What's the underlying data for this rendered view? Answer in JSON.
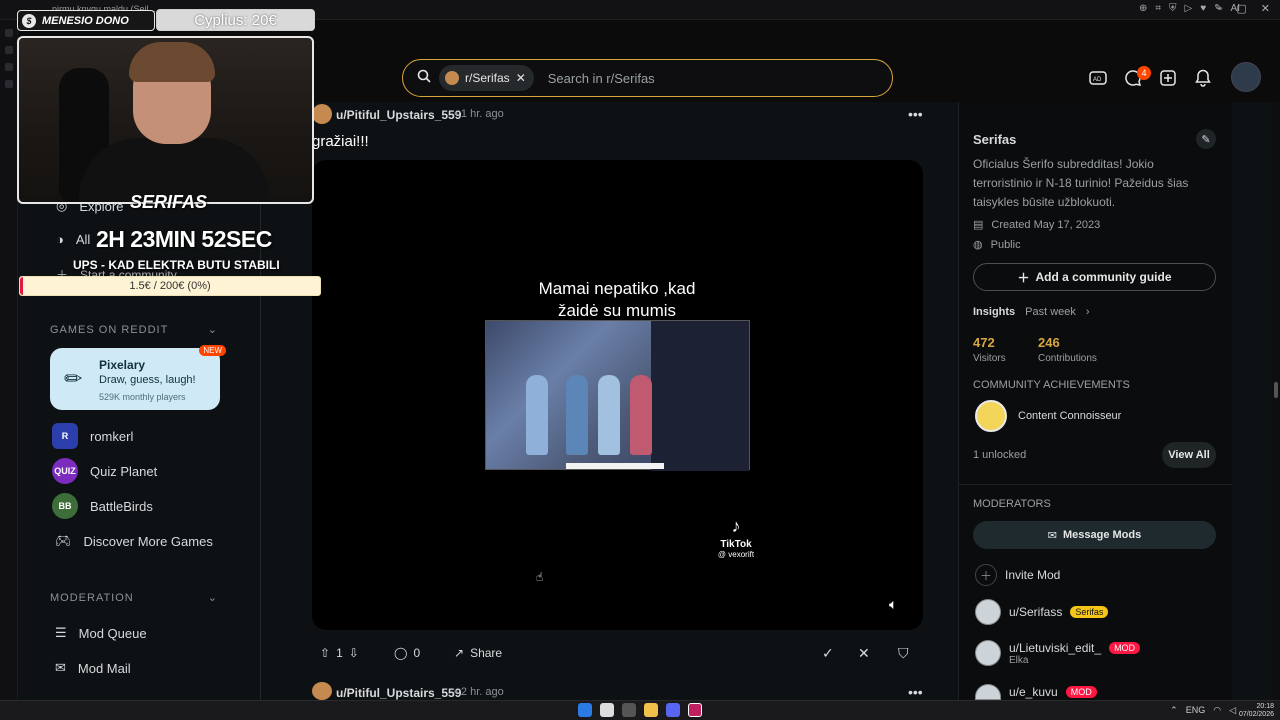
{
  "browser": {
    "tab_title": "pirmų knygų maldų (Seil...",
    "extension_label": "AI"
  },
  "overlay": {
    "streamer_name": "MENESIO DONO",
    "donation": "Cyplius: 20€",
    "channel_name": "SERIFAS",
    "timer": "2H 23MIN 52SEC",
    "goal_text": "UPS - KAD ELEKTRA BUTU STABILI",
    "goal_progress": "1.5€ / 200€ (0%)",
    "goal_fraction": 0.0075
  },
  "search": {
    "chip_label": "r/Serifas",
    "placeholder": "Search in r/Serifas"
  },
  "header": {
    "chat_badge": "4"
  },
  "sidebar": {
    "nav": [
      {
        "label": "Explore",
        "icon": "explore-icon"
      },
      {
        "label": "All",
        "icon": "all-icon"
      },
      {
        "label": "Start a community",
        "icon": "plus-icon"
      }
    ],
    "games_heading": "GAMES ON REDDIT",
    "featured_game": {
      "name": "Pixelary",
      "tagline": "Draw, guess, laugh!",
      "players": "529K monthly players",
      "badge": "NEW"
    },
    "games": [
      {
        "label": "romkerl",
        "icon": "R"
      },
      {
        "label": "Quiz Planet",
        "icon": "QUIZ"
      },
      {
        "label": "BattleBirds",
        "icon": "BB"
      },
      {
        "label": "Discover More Games",
        "icon": "gamepad-icon"
      }
    ],
    "moderation_heading": "MODERATION",
    "moderation": [
      {
        "label": "Mod Queue"
      },
      {
        "label": "Mod Mail"
      }
    ]
  },
  "post": {
    "author": "u/Pitiful_Upstairs_559",
    "time": "• 1 hr. ago",
    "title": "gražiai!!!",
    "video_caption_line1": "Mamai nepatiko ,kad",
    "video_caption_line2": "žaidė su mumis",
    "tiktok_name": "TikTok",
    "tiktok_handle": "@ vexorift",
    "votes": "1",
    "comments": "0",
    "share_label": "Share"
  },
  "post2": {
    "author": "u/Pitiful_Upstairs_559",
    "time": "• 2 hr. ago"
  },
  "community": {
    "name": "Serifas",
    "description": "Oficialus Šerifo subredditas! Jokio terroristinio ir N-18 turinio! Pažeidus šias taisykles būsite užblokuoti.",
    "created": "Created May 17, 2023",
    "visibility": "Public",
    "guide_button": "Add a community guide",
    "insights_label": "Insights",
    "insights_range": "Past week",
    "visitors_value": "472",
    "visitors_label": "Visitors",
    "contributions_value": "246",
    "contributions_label": "Contributions",
    "achievements_heading": "COMMUNITY ACHIEVEMENTS",
    "achievement_name": "Content Connoisseur",
    "unlocked": "1 unlocked",
    "view_all": "View All",
    "moderators_heading": "MODERATORS",
    "message_mods": "Message Mods",
    "invite_mod": "Invite Mod",
    "mods": [
      {
        "name": "u/Serifass",
        "flair": "Serifas",
        "flair_style": "yellow",
        "sub": ""
      },
      {
        "name": "u/Lietuviski_edit_",
        "flair": "MOD",
        "flair_style": "red",
        "sub": "Elka"
      },
      {
        "name": "u/e_kuvu",
        "flair": "MOD",
        "flair_style": "red",
        "sub": ""
      }
    ]
  },
  "taskbar": {
    "lang": "ENG",
    "time": "20:18",
    "date": "07/02/2026"
  },
  "colors": {
    "accent": "#ff4500",
    "search_border": "#d8a640",
    "page_bg": "#0e1113"
  }
}
